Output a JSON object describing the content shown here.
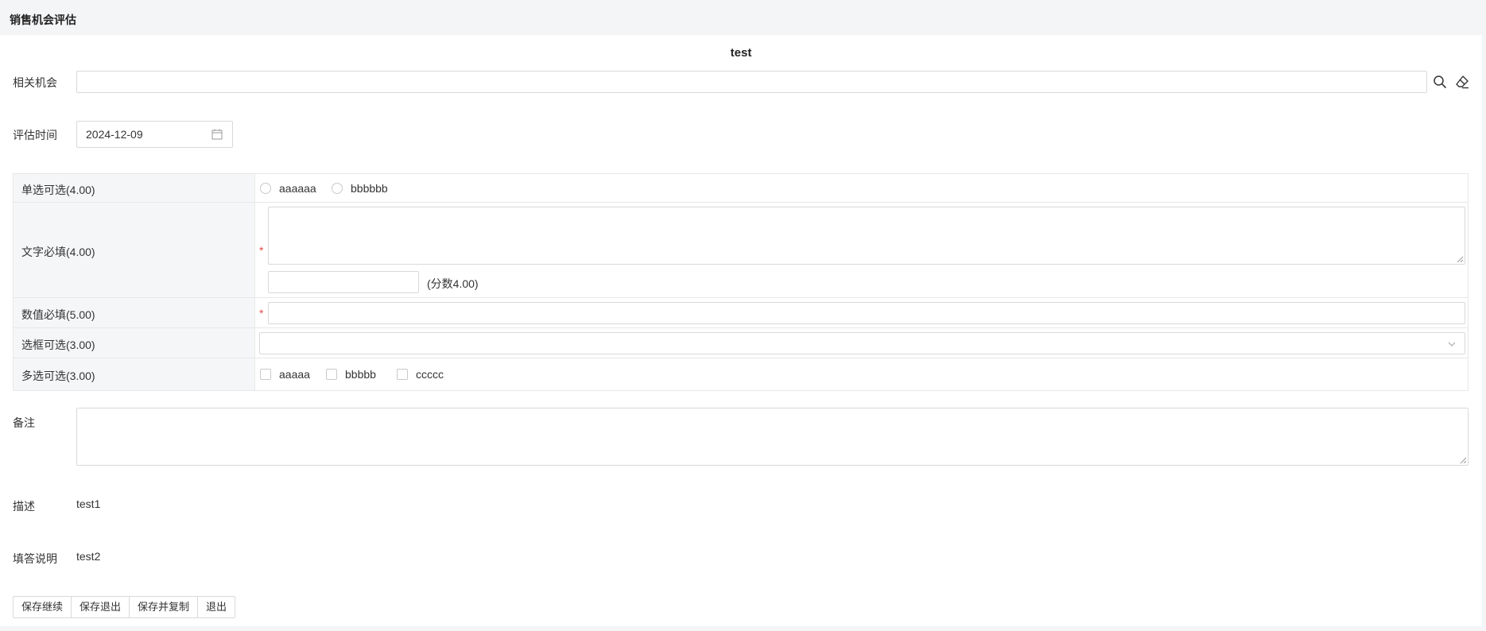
{
  "page": {
    "title": "销售机会评估"
  },
  "form": {
    "title": "test",
    "related_opportunity": {
      "label": "相关机会",
      "value": ""
    },
    "eval_time": {
      "label": "评估时间",
      "value": "2024-12-09"
    },
    "questions": [
      {
        "label": "单选可选(4.00)",
        "type": "radio",
        "options": [
          "aaaaaa",
          "bbbbbb"
        ]
      },
      {
        "label": "文字必填(4.00)",
        "type": "text",
        "required": "*",
        "score_note": "(分数4.00)"
      },
      {
        "label": "数值必填(5.00)",
        "type": "number",
        "required": "*"
      },
      {
        "label": "选框可选(3.00)",
        "type": "select",
        "value": ""
      },
      {
        "label": "多选可选(3.00)",
        "type": "checkbox",
        "options": [
          "aaaaa",
          "bbbbb",
          "ccccc"
        ]
      }
    ],
    "remark": {
      "label": "备注",
      "value": ""
    },
    "description": {
      "label": "描述",
      "value": "test1"
    },
    "instructions": {
      "label": "填答说明",
      "value": "test2"
    }
  },
  "buttons": {
    "save_continue": "保存继续",
    "save_exit": "保存退出",
    "save_copy": "保存并复制",
    "exit": "退出"
  },
  "icons": {
    "search": "search-icon",
    "clear": "eraser-icon",
    "calendar": "calendar-icon",
    "dropdown": "chevron-down-icon"
  },
  "colors": {
    "required": "#e34d4d",
    "border": "#d9d9d9",
    "label_bg": "#f5f6f8"
  }
}
